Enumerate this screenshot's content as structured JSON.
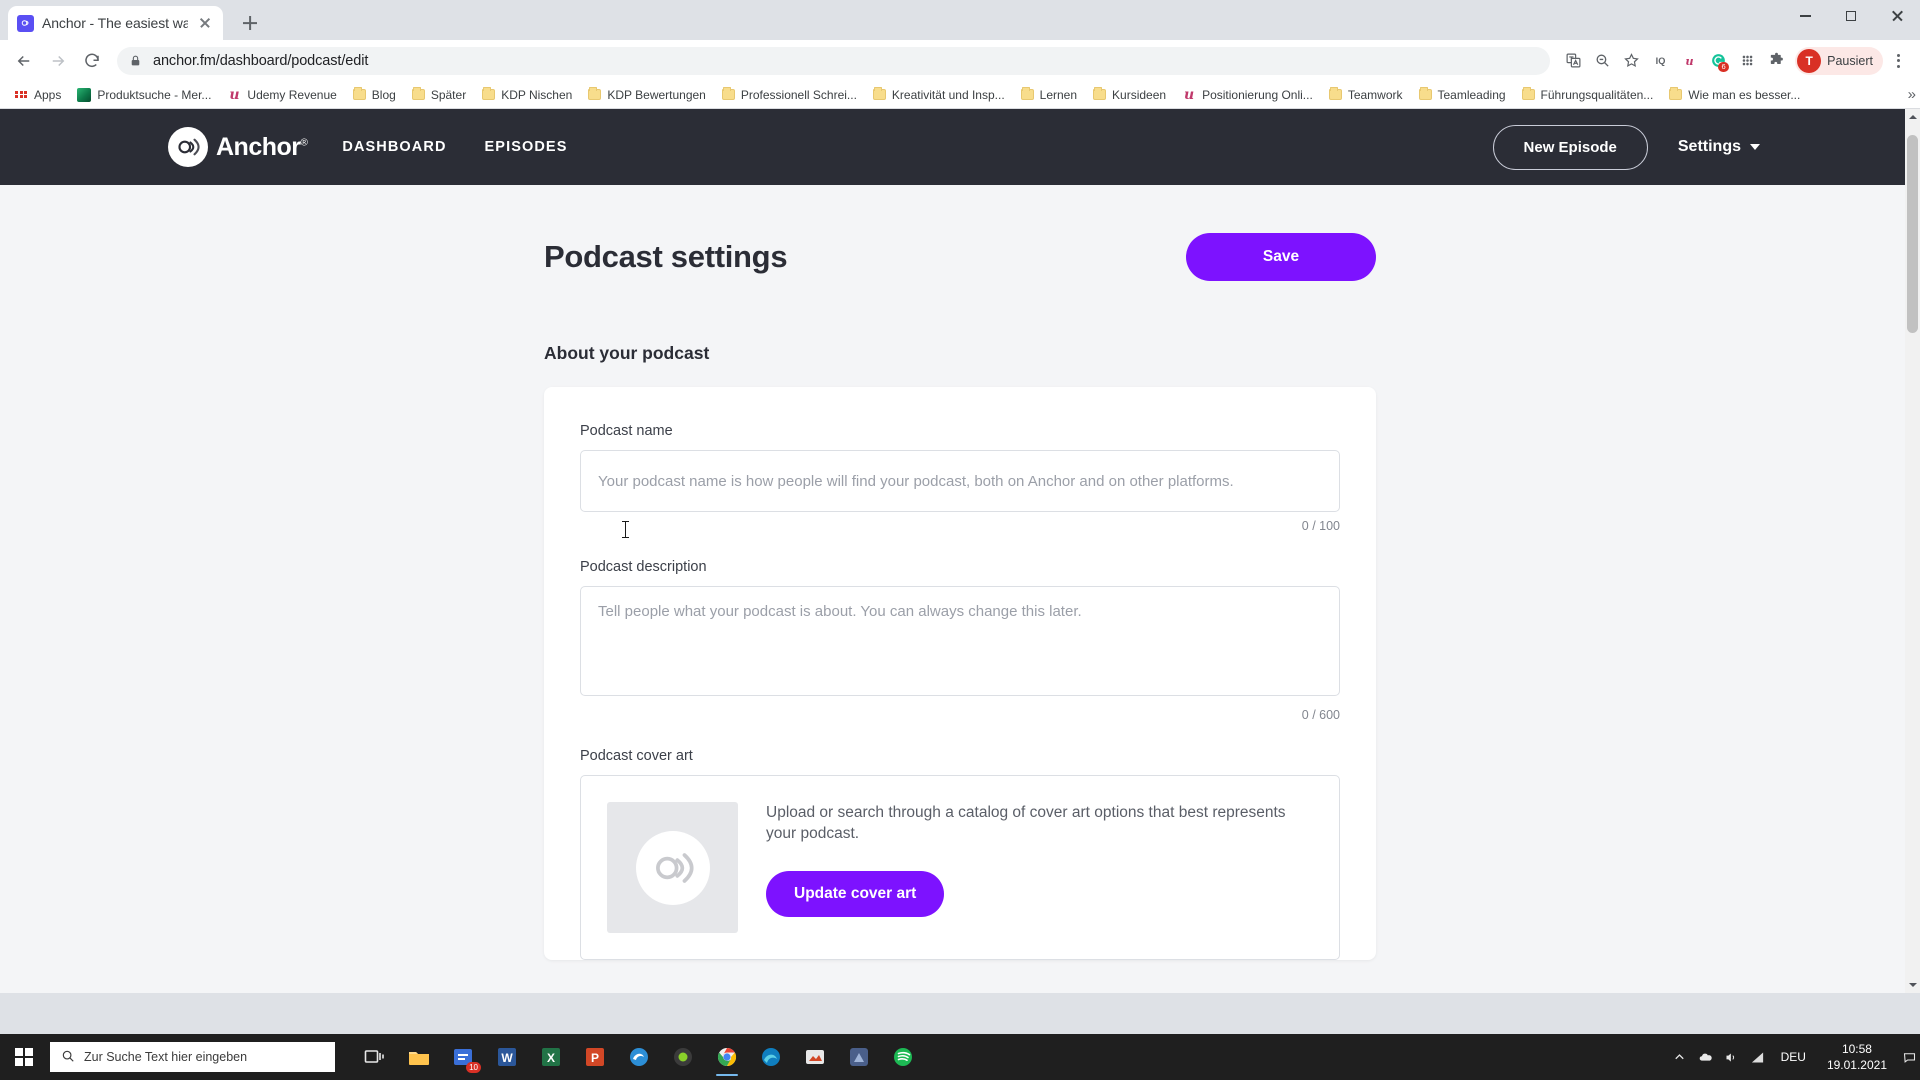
{
  "browser": {
    "tab": {
      "title": "Anchor - The easiest way to mak",
      "favicon": "anchor-favicon"
    },
    "new_tab_label": "+",
    "url": "anchor.fm/dashboard/podcast/edit",
    "lock_icon": "lock-icon",
    "toolbar_icons": [
      "translate-icon",
      "zoom-icon",
      "bookmark-star-icon",
      "iq-extension-icon",
      "udemy-extension-icon",
      "grammarly-extension-icon",
      "apps-grid-icon",
      "extensions-puzzle-icon"
    ],
    "extension_badge": "6",
    "profile": {
      "initial": "T",
      "label": "Pausiert"
    },
    "menu_icon": "kebab-menu-icon",
    "window_controls": [
      "minimize-icon",
      "maximize-icon",
      "close-icon"
    ],
    "bookmarks": [
      {
        "label": "Apps",
        "icon": "apps-grid-icon"
      },
      {
        "label": "Produktsuche - Mer...",
        "icon": "site-favicon"
      },
      {
        "label": "Udemy Revenue",
        "icon": "udemy-favicon"
      },
      {
        "label": "Blog",
        "icon": "folder-icon"
      },
      {
        "label": "Später",
        "icon": "folder-icon"
      },
      {
        "label": "KDP Nischen",
        "icon": "folder-icon"
      },
      {
        "label": "KDP Bewertungen",
        "icon": "folder-icon"
      },
      {
        "label": "Professionell Schrei...",
        "icon": "folder-icon"
      },
      {
        "label": "Kreativität und Insp...",
        "icon": "folder-icon"
      },
      {
        "label": "Lernen",
        "icon": "folder-icon"
      },
      {
        "label": "Kursideen",
        "icon": "folder-icon"
      },
      {
        "label": "Positionierung Onli...",
        "icon": "udemy-favicon"
      },
      {
        "label": "Teamwork",
        "icon": "folder-icon"
      },
      {
        "label": "Teamleading",
        "icon": "folder-icon"
      },
      {
        "label": "Führungsqualitäten...",
        "icon": "folder-icon"
      },
      {
        "label": "Wie man es besser...",
        "icon": "folder-icon"
      }
    ],
    "bookmarks_overflow": "»"
  },
  "app": {
    "brand": {
      "name": "Anchor",
      "registered": "®",
      "icon": "anchor-logo-icon"
    },
    "nav_links": [
      {
        "label": "DASHBOARD"
      },
      {
        "label": "EPISODES"
      }
    ],
    "new_episode_label": "New Episode",
    "settings_label": "Settings",
    "settings_caret": "chevron-down-icon"
  },
  "page": {
    "title": "Podcast settings",
    "save_label": "Save",
    "section_title": "About your podcast",
    "fields": {
      "name": {
        "label": "Podcast name",
        "value": "",
        "placeholder": "Your podcast name is how people will find your podcast, both on Anchor and on other platforms.",
        "counter": "0 / 100"
      },
      "description": {
        "label": "Podcast description",
        "value": "",
        "placeholder": "Tell people what your podcast is about. You can always change this later.",
        "counter": "0 / 600"
      },
      "cover": {
        "label": "Podcast cover art",
        "thumb_icon": "anchor-logo-icon",
        "text": "Upload or search through a catalog of cover art options that best represents your podcast.",
        "button_label": "Update cover art"
      }
    },
    "colors": {
      "accent": "#7d12ff",
      "nav_bg": "#2b2d36",
      "page_bg": "#f4f5f7"
    }
  },
  "taskbar": {
    "start_icon": "windows-logo-icon",
    "search_placeholder": "Zur Suche Text hier eingeben",
    "search_icon": "search-icon",
    "apps": [
      {
        "name": "task-view-icon",
        "badge": ""
      },
      {
        "name": "file-explorer-icon",
        "badge": ""
      },
      {
        "name": "store-icon",
        "badge": "10"
      },
      {
        "name": "word-icon",
        "badge": ""
      },
      {
        "name": "excel-icon",
        "badge": ""
      },
      {
        "name": "powerpoint-icon",
        "badge": ""
      },
      {
        "name": "edge-legacy-icon",
        "badge": ""
      },
      {
        "name": "camtasia-icon",
        "badge": ""
      },
      {
        "name": "chrome-icon",
        "badge": ""
      },
      {
        "name": "edge-icon",
        "badge": ""
      },
      {
        "name": "snagit-icon",
        "badge": ""
      },
      {
        "name": "affinity-icon",
        "badge": ""
      },
      {
        "name": "spotify-icon",
        "badge": ""
      }
    ],
    "tray_icons": [
      "chevron-up-icon",
      "onedrive-icon",
      "volume-icon",
      "network-icon"
    ],
    "language": "DEU",
    "time": "10:58",
    "date": "19.01.2021",
    "notification_icon": "notifications-icon"
  }
}
